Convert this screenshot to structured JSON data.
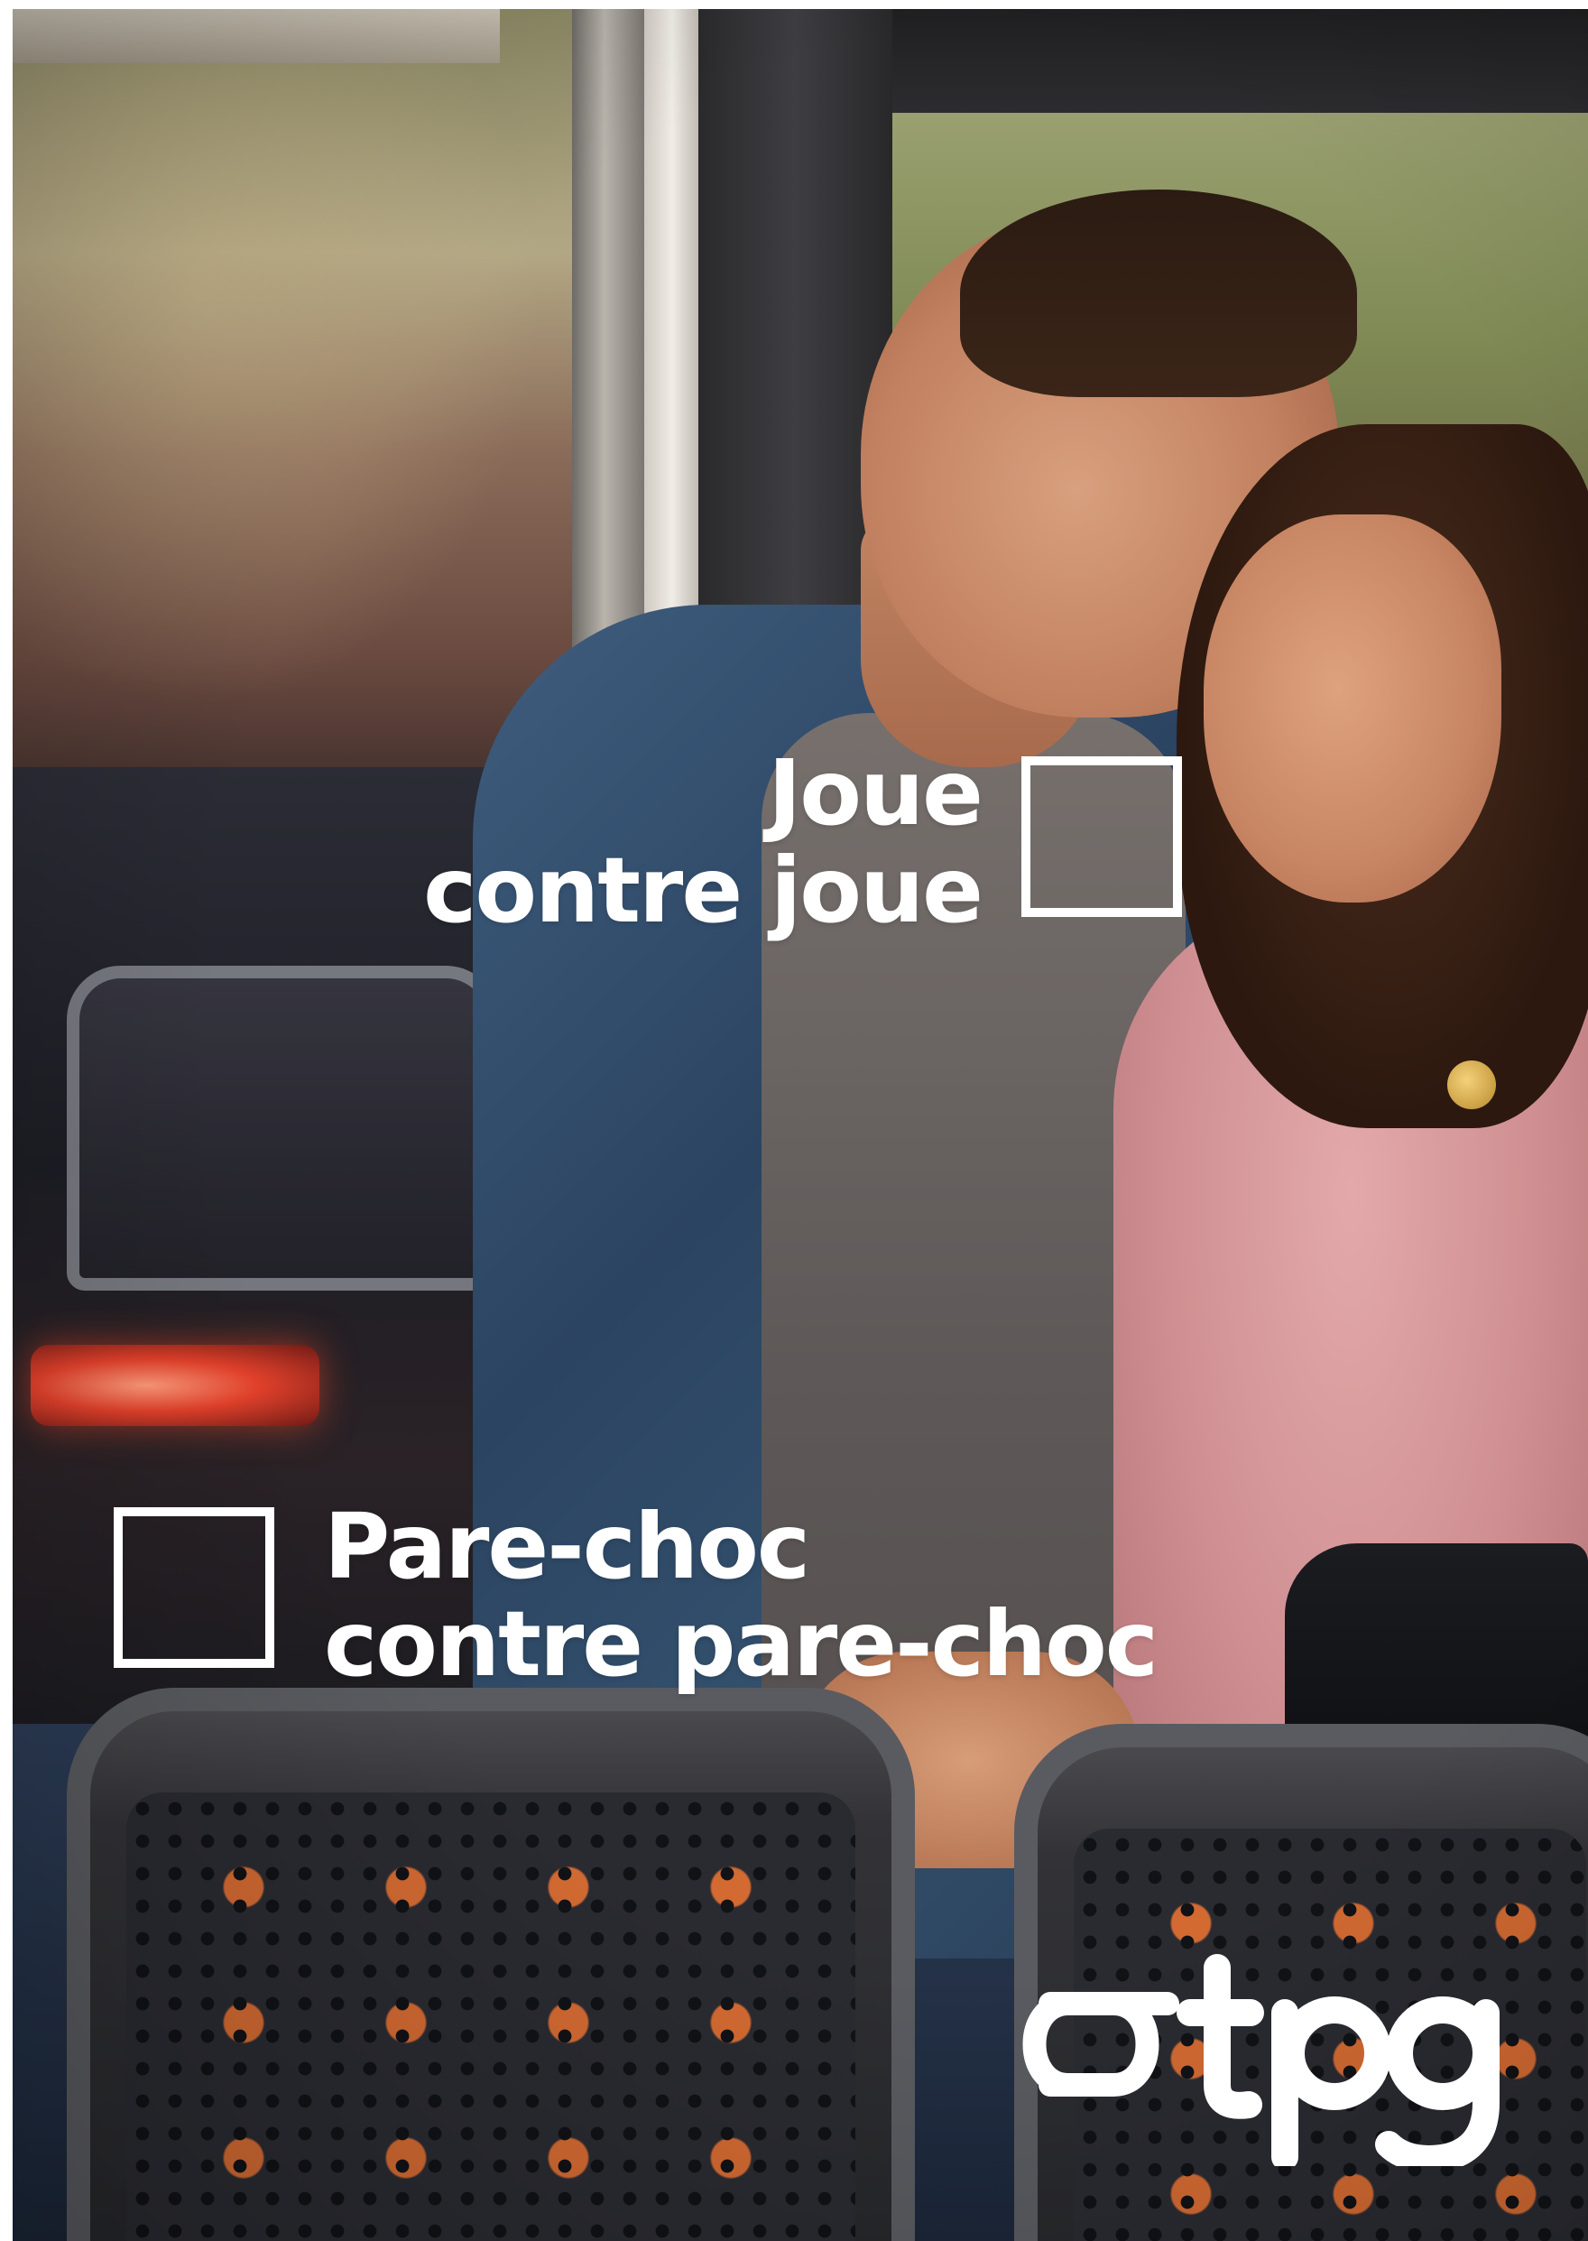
{
  "poster": {
    "headline_top": {
      "line1": "Joue",
      "line2": "contre joue"
    },
    "headline_bottom": {
      "line1": "Pare-choc",
      "line2": "contre pare-choc"
    },
    "brand": {
      "logo_text": "tpg",
      "color": "#ffffff"
    }
  }
}
